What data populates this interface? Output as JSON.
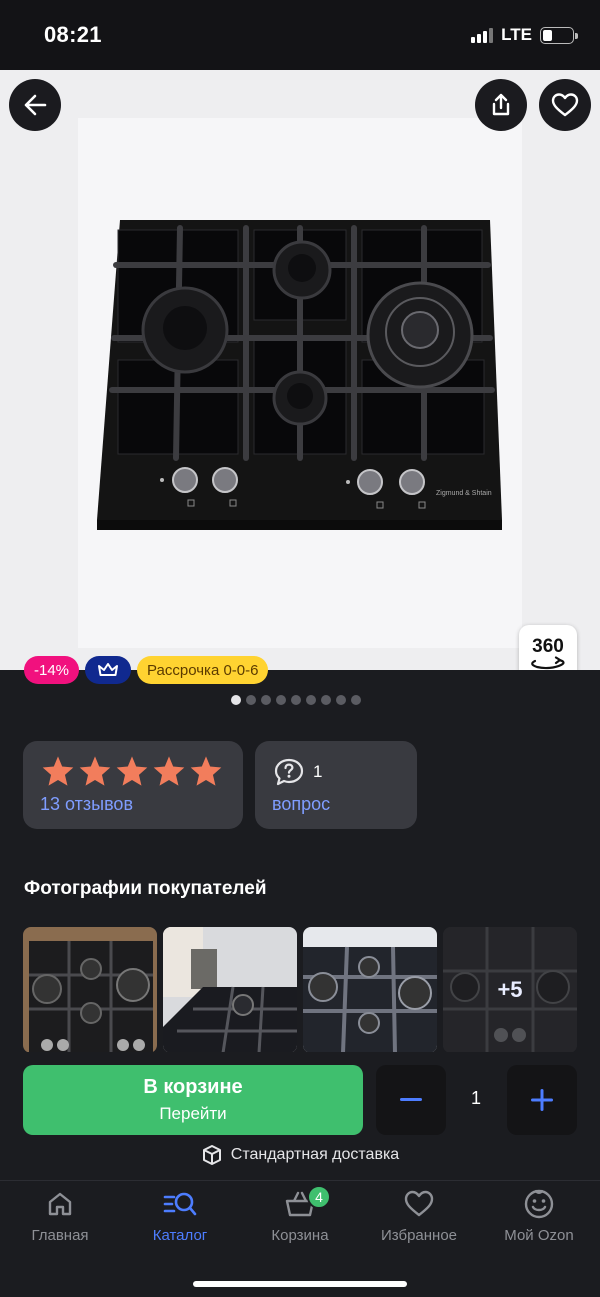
{
  "status": {
    "time": "08:21",
    "network": "LTE"
  },
  "colors": {
    "accent": "#4d7dff",
    "buy_green": "#3fbf6e",
    "star": "#f27d5c",
    "discount_pink": "#f1117e",
    "installment_yellow": "#ffd331",
    "premium_blue": "#10298f"
  },
  "product": {
    "badge_360": "360",
    "brand_text": "Zigmund & Shtain",
    "pills": {
      "discount": "-14%",
      "installment": "Рассрочка 0-0-6",
      "premium_icon": "crown-icon"
    },
    "gallery": {
      "total": 9,
      "active": 0
    },
    "rating": {
      "stars": 5,
      "max": 5,
      "reviews_label": "13 отзывов"
    },
    "questions": {
      "count": "1",
      "label": "вопрос"
    }
  },
  "buyer_photos": {
    "title": "Фотографии покупателей",
    "more_label": "+5"
  },
  "cart": {
    "button_main": "В корзине",
    "button_sub": "Перейти",
    "quantity": "1",
    "delivery": "Стандартная доставка"
  },
  "tabs": [
    {
      "label": "Главная",
      "icon": "home-icon"
    },
    {
      "label": "Каталог",
      "icon": "catalog-icon"
    },
    {
      "label": "Корзина",
      "icon": "basket-icon",
      "badge": "4"
    },
    {
      "label": "Избранное",
      "icon": "heart-icon"
    },
    {
      "label": "Мой Ozon",
      "icon": "profile-icon"
    }
  ]
}
